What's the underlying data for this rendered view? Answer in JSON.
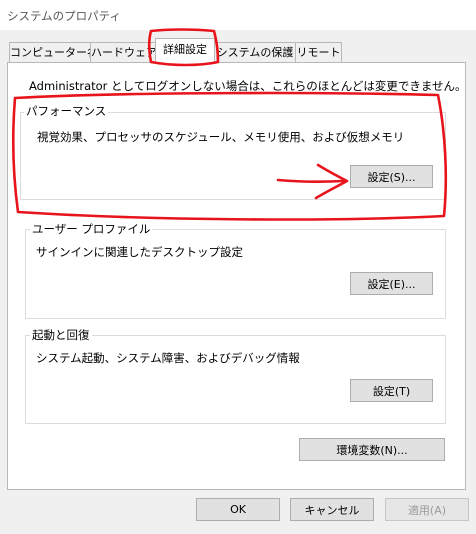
{
  "window": {
    "title": "システムのプロパティ"
  },
  "tabs": [
    {
      "label": "コンピューター名",
      "active": false
    },
    {
      "label": "ハードウェア",
      "active": false
    },
    {
      "label": "詳細設定",
      "active": true
    },
    {
      "label": "システムの保護",
      "active": false
    },
    {
      "label": "リモート",
      "active": false
    }
  ],
  "notice": "Administrator としてログオンしない場合は、これらのほとんどは変更できません。",
  "performance": {
    "title": "パフォーマンス",
    "description": "視覚効果、プロセッサのスケジュール、メモリ使用、および仮想メモリ",
    "button": "設定(S)..."
  },
  "user_profiles": {
    "title": "ユーザー プロファイル",
    "description": "サインインに関連したデスクトップ設定",
    "button": "設定(E)..."
  },
  "startup_recovery": {
    "title": "起動と回復",
    "description": "システム起動、システム障害、およびデバッグ情報",
    "button": "設定(T)"
  },
  "env_button": "環境変数(N)...",
  "footer": {
    "ok": "OK",
    "cancel": "キャンセル",
    "apply": "適用(A)"
  },
  "colors": {
    "annotation": "#e8141c",
    "button_face": "#e1e1e1",
    "panel_bg": "#ffffff",
    "window_bg": "#f0f0f0"
  }
}
